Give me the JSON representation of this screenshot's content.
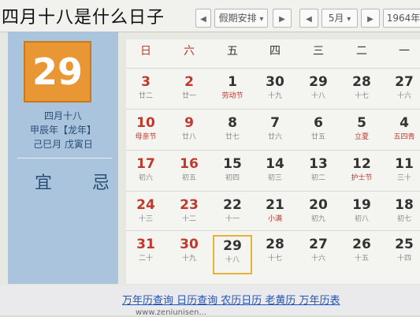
{
  "caption": "四月十八是什么日子",
  "toolbar": {
    "holiday_label": "假期安排",
    "month_label": "5月",
    "year_label": "1964年",
    "prev_icon": "chevron-left-icon",
    "next_icon": "chevron-right-icon"
  },
  "panel": {
    "day": "29",
    "lunar_date": "四月十八",
    "ganzhi_year": "甲辰年【龙年】",
    "ganzhi_day": "己巳月 戊寅日",
    "yi_ji": "宜 忌"
  },
  "weekdays": [
    "日",
    "六",
    "五",
    "四",
    "三",
    "二",
    "一"
  ],
  "rows": [
    [
      {
        "n": "3",
        "s": "廿二",
        "r": true
      },
      {
        "n": "2",
        "s": "廿一",
        "r": true
      },
      {
        "n": "1",
        "s": "劳动节",
        "r": false,
        "sr": true
      },
      {
        "n": "30",
        "s": "十九"
      },
      {
        "n": "29",
        "s": "十八"
      },
      {
        "n": "28",
        "s": "十七"
      },
      {
        "n": "27",
        "s": "十六"
      }
    ],
    [
      {
        "n": "10",
        "s": "母亲节",
        "r": true,
        "sr": true
      },
      {
        "n": "9",
        "s": "廿八",
        "r": true
      },
      {
        "n": "8",
        "s": "廿七"
      },
      {
        "n": "7",
        "s": "廿六"
      },
      {
        "n": "6",
        "s": "廿五"
      },
      {
        "n": "5",
        "s": "立夏",
        "sr": true
      },
      {
        "n": "4",
        "s": "五四青",
        "sr": true
      }
    ],
    [
      {
        "n": "17",
        "s": "初六",
        "r": true
      },
      {
        "n": "16",
        "s": "初五",
        "r": true
      },
      {
        "n": "15",
        "s": "初四"
      },
      {
        "n": "14",
        "s": "初三"
      },
      {
        "n": "13",
        "s": "初二"
      },
      {
        "n": "12",
        "s": "护士节",
        "sr": true
      },
      {
        "n": "11",
        "s": "三十"
      }
    ],
    [
      {
        "n": "24",
        "s": "十三",
        "r": true
      },
      {
        "n": "23",
        "s": "十二",
        "r": true
      },
      {
        "n": "22",
        "s": "十一"
      },
      {
        "n": "21",
        "s": "小满",
        "sr": true
      },
      {
        "n": "20",
        "s": "初九"
      },
      {
        "n": "19",
        "s": "初八"
      },
      {
        "n": "18",
        "s": "初七"
      }
    ],
    [
      {
        "n": "31",
        "s": "二十",
        "r": true
      },
      {
        "n": "30",
        "s": "十九",
        "r": true
      },
      {
        "n": "29",
        "s": "十八",
        "today": true
      },
      {
        "n": "28",
        "s": "十七"
      },
      {
        "n": "27",
        "s": "十六"
      },
      {
        "n": "26",
        "s": "十五"
      },
      {
        "n": "25",
        "s": "十四"
      }
    ]
  ],
  "footer": {
    "links": "万年历查询 日历查询 农历日历 老黄历 万年历表",
    "sub": "www.zeniunisen..."
  }
}
